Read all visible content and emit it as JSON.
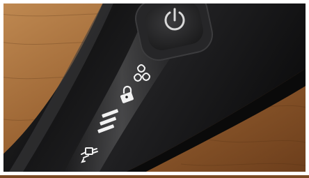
{
  "scene": {
    "description_icons": [
      "power-icon",
      "cleaning-cartridge-icon",
      "lock-icon",
      "battery-level-icon",
      "charging-plug-icon"
    ],
    "battery_bars": 3,
    "colors": {
      "wood_light": "#b8834d",
      "wood_dark": "#6e3f1c",
      "body": "#1a1a1b",
      "body_highlight": "#4a4a4c",
      "icon_white": "#f2f2f2",
      "button_ring": "#2b2b2d"
    }
  }
}
